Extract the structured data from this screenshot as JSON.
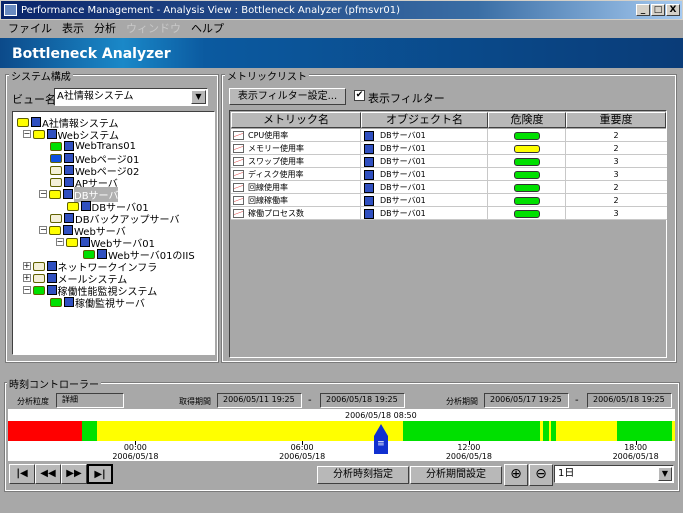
{
  "window": {
    "title": "Performance Management - Analysis View : Bottleneck Analyzer (pfmsvr01)",
    "minimize": "_",
    "maximize": "□",
    "close": "X"
  },
  "menu": [
    {
      "label": "ファイル",
      "enabled": true
    },
    {
      "label": "表示",
      "enabled": true
    },
    {
      "label": "分析",
      "enabled": true
    },
    {
      "label": "ウィンドウ",
      "enabled": false
    },
    {
      "label": "ヘルプ",
      "enabled": true
    }
  ],
  "banner": {
    "title": "Bottleneck Analyzer"
  },
  "system": {
    "group_label": "システム構成",
    "view_label": "ビュー名",
    "view_value": "A社情報システム",
    "tree": [
      {
        "label": "A社情報システム",
        "level": 0,
        "status": "yellow",
        "expander": ""
      },
      {
        "label": "Webシステム",
        "level": 1,
        "status": "yellow",
        "expander": "−"
      },
      {
        "label": "WebTrans01",
        "level": 2,
        "status": "green",
        "expander": ""
      },
      {
        "label": "Webページ01",
        "level": 2,
        "status": "blue",
        "expander": ""
      },
      {
        "label": "Webページ02",
        "level": 2,
        "status": "pale",
        "expander": ""
      },
      {
        "label": "APサーバ",
        "level": 2,
        "status": "pale",
        "expander": ""
      },
      {
        "label": "DBサーバ",
        "level": 2,
        "status": "yellow",
        "expander": "−",
        "selected": true
      },
      {
        "label": "DBサーバ01",
        "level": 3,
        "status": "yellow",
        "expander": ""
      },
      {
        "label": "DBバックアップサーバ",
        "level": 2,
        "status": "pale",
        "expander": ""
      },
      {
        "label": "Webサーバ",
        "level": 2,
        "status": "yellow",
        "expander": "−"
      },
      {
        "label": "Webサーバ01",
        "level": 3,
        "status": "yellow",
        "expander": "−"
      },
      {
        "label": "Webサーバ01のIIS",
        "level": 4,
        "status": "green",
        "expander": ""
      },
      {
        "label": "ネットワークインフラ",
        "level": 1,
        "status": "pale",
        "expander": "+"
      },
      {
        "label": "メールシステム",
        "level": 1,
        "status": "pale",
        "expander": "+"
      },
      {
        "label": "稼働性能監視システム",
        "level": 1,
        "status": "green",
        "expander": "−"
      },
      {
        "label": "稼働監視サーバ",
        "level": 2,
        "status": "green",
        "expander": ""
      }
    ]
  },
  "metrics": {
    "group_label": "メトリックリスト",
    "filter_button": "表示フィルター設定...",
    "filter_checkbox": "表示フィルター",
    "filter_checked": true,
    "columns": [
      "メトリック名",
      "オブジェクト名",
      "危険度",
      "重要度"
    ],
    "rows": [
      {
        "metric": "CPU使用率",
        "object": "DBサーバ01",
        "risk": "green",
        "importance": "2"
      },
      {
        "metric": "メモリー使用率",
        "object": "DBサーバ01",
        "risk": "yellow",
        "importance": "2"
      },
      {
        "metric": "スワップ使用率",
        "object": "DBサーバ01",
        "risk": "green",
        "importance": "3"
      },
      {
        "metric": "ディスク使用率",
        "object": "DBサーバ01",
        "risk": "green",
        "importance": "3"
      },
      {
        "metric": "回線使用率",
        "object": "DBサーバ01",
        "risk": "green",
        "importance": "2"
      },
      {
        "metric": "回線稼働率",
        "object": "DBサーバ01",
        "risk": "green",
        "importance": "2"
      },
      {
        "metric": "稼働プロセス数",
        "object": "DBサーバ01",
        "risk": "green",
        "importance": "3"
      }
    ]
  },
  "time": {
    "group_label": "時刻コントローラー",
    "granularity_label": "分析粒度",
    "granularity_value": "詳細",
    "collect_label": "取得期間",
    "collect_from": "2006/05/11 19:25",
    "collect_to": "2006/05/18 19:25",
    "analysis_label": "分析期間",
    "analysis_from": "2006/05/17 19:25",
    "analysis_to": "2006/05/18 19:25",
    "dash": "-",
    "cursor": "2006/05/18 08:50",
    "ticks": [
      {
        "time": "00:00",
        "date": "2006/05/18"
      },
      {
        "time": "06:00",
        "date": "2006/05/18"
      },
      {
        "time": "12:00",
        "date": "2006/05/18"
      },
      {
        "time": "18:00",
        "date": "2006/05/18"
      }
    ],
    "segments": [
      {
        "from": "2006/05/17 19:25",
        "to": "2006/05/17 22:05",
        "status": "red"
      },
      {
        "from": "2006/05/17 22:05",
        "to": "2006/05/17 22:37",
        "status": "green"
      },
      {
        "from": "2006/05/17 22:37",
        "to": "2006/05/18 09:38",
        "status": "yellow"
      },
      {
        "from": "2006/05/18 09:38",
        "to": "2006/05/18 14:34",
        "status": "green"
      },
      {
        "from": "2006/05/18 14:34",
        "to": "2006/05/18 14:40",
        "status": "yellow"
      },
      {
        "from": "2006/05/18 14:40",
        "to": "2006/05/18 14:52",
        "status": "green"
      },
      {
        "from": "2006/05/18 14:52",
        "to": "2006/05/18 14:58",
        "status": "yellow"
      },
      {
        "from": "2006/05/18 14:58",
        "to": "2006/05/18 15:08",
        "status": "green"
      },
      {
        "from": "2006/05/18 15:08",
        "to": "2006/05/18 17:20",
        "status": "yellow"
      },
      {
        "from": "2006/05/18 17:20",
        "to": "2006/05/18 19:19",
        "status": "green"
      },
      {
        "from": "2006/05/18 19:19",
        "to": "2006/05/18 19:25",
        "status": "yellow"
      }
    ],
    "nav_buttons": [
      "|◀",
      "◀◀",
      "▶▶",
      "▶|"
    ],
    "set_time_button": "分析時刻指定",
    "set_period_button": "分析期間設定",
    "zoom_in": "⊕",
    "zoom_out": "⊖",
    "range_value": "1日"
  },
  "colors": {
    "red": "#ff0000",
    "green": "#00e000",
    "yellow": "#ffff00",
    "blue": "#1050e0",
    "pale": "#f4f0d8"
  }
}
